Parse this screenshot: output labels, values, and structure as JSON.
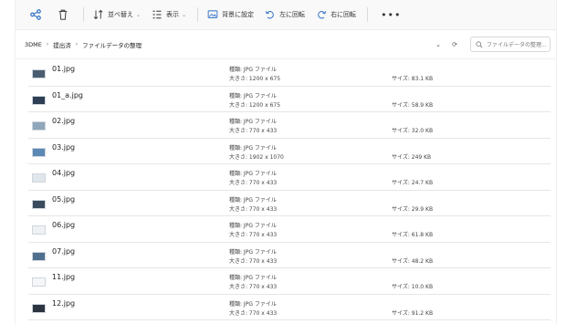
{
  "toolbar": {
    "sort_label": "並べ替え",
    "view_label": "表示",
    "set_bg_label": "背景に設定",
    "rotate_left_label": "左に回転",
    "rotate_right_label": "右に回転",
    "more_label": "•••"
  },
  "address": {
    "crumbs": [
      "3DME",
      "提出済",
      "ファイルデータの整理"
    ],
    "search_placeholder": "ファイルデータの整理..."
  },
  "files": [
    {
      "name": "01.jpg",
      "type": "種類: JPG ファイル",
      "dims": "大きさ: 1200 x 675",
      "size": "サイズ: 83.1 KB",
      "thumb_color": "#4a5d70"
    },
    {
      "name": "01_a.jpg",
      "type": "種類: JPG ファイル",
      "dims": "大きさ: 1200 x 675",
      "size": "サイズ: 58.9 KB",
      "thumb_color": "#2e3f55"
    },
    {
      "name": "02.jpg",
      "type": "種類: JPG ファイル",
      "dims": "大きさ: 770 x 433",
      "size": "サイズ: 32.0 KB",
      "thumb_color": "#8fa6bb"
    },
    {
      "name": "03.jpg",
      "type": "種類: JPG ファイル",
      "dims": "大きさ: 1902 x 1070",
      "size": "サイズ: 249 KB",
      "thumb_color": "#5b88b5"
    },
    {
      "name": "04.jpg",
      "type": "種類: JPG ファイル",
      "dims": "大きさ: 770 x 433",
      "size": "サイズ: 24.7 KB",
      "thumb_color": "#dfe6ec"
    },
    {
      "name": "05.jpg",
      "type": "種類: JPG ファイル",
      "dims": "大きさ: 770 x 433",
      "size": "サイズ: 29.9 KB",
      "thumb_color": "#3a4b5e"
    },
    {
      "name": "06.jpg",
      "type": "種類: JPG ファイル",
      "dims": "大きさ: 770 x 433",
      "size": "サイズ: 61.8 KB",
      "thumb_color": "#eef1f4"
    },
    {
      "name": "07.jpg",
      "type": "種類: JPG ファイル",
      "dims": "大きさ: 770 x 433",
      "size": "サイズ: 48.2 KB",
      "thumb_color": "#4f6f8f"
    },
    {
      "name": "11.jpg",
      "type": "種類: JPG ファイル",
      "dims": "大きさ: 770 x 433",
      "size": "サイズ: 10.0 KB",
      "thumb_color": "#f4f6f8"
    },
    {
      "name": "12.jpg",
      "type": "種類: JPG ファイル",
      "dims": "大きさ: 770 x 433",
      "size": "サイズ: 91.2 KB",
      "thumb_color": "#2b3440"
    }
  ]
}
